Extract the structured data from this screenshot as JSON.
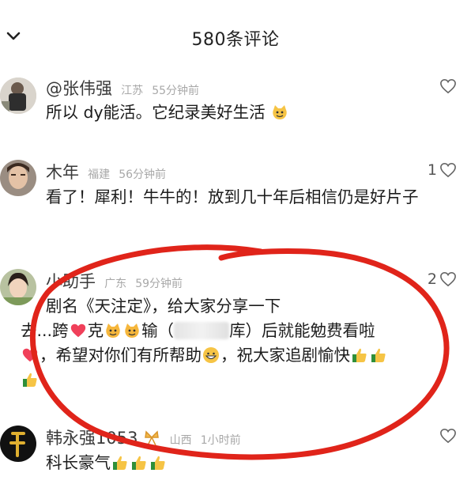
{
  "header": {
    "title": "580条评论",
    "collapse_icon": "chevron-down-icon"
  },
  "comments": [
    {
      "user": "@张伟强",
      "location": "江苏",
      "time": "55分钟前",
      "likes": "",
      "text": "所以 dy能活。它纪录美好生活"
    },
    {
      "user": "木年",
      "location": "福建",
      "time": "56分钟前",
      "likes": "1",
      "text": "看了！犀利！牛牛的！放到几十年后相信仍是好片子"
    },
    {
      "user": "小助手",
      "location": "广东",
      "time": "59分钟前",
      "likes": "2",
      "line1": "剧名《天注定》，给大家分享一下",
      "line2a": "去...跨",
      "line2b": "克",
      "line2c": "输（",
      "line2d": "库）后就能勉费看啦",
      "line3a": "，希望对你们有所帮助",
      "line3b": "，祝大家追剧愉快"
    },
    {
      "user": "韩永强1053",
      "location": "山西",
      "time": "1小时前",
      "likes": "",
      "text": "科长豪气"
    }
  ],
  "colors": {
    "annotation_circle": "#e0241a",
    "heart": "#f0405a"
  }
}
